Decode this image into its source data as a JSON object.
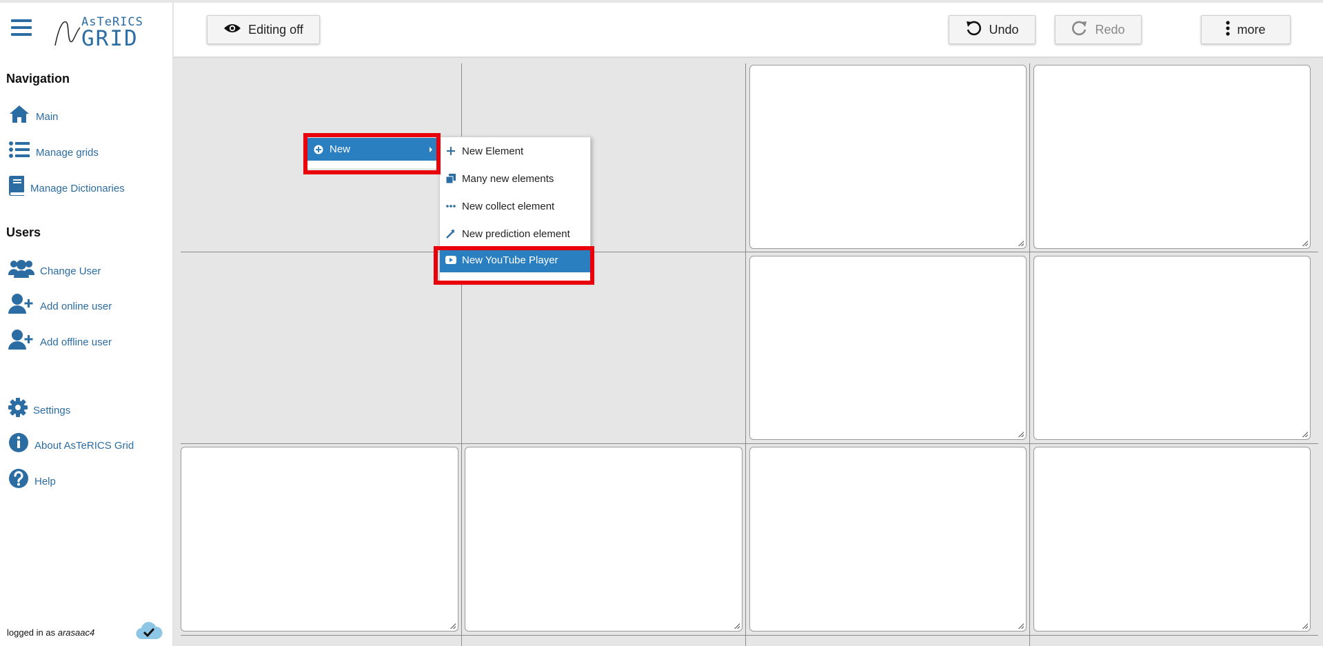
{
  "app": {
    "logo_top": "AsTeRICS",
    "logo_bottom": "GRID"
  },
  "sidebar": {
    "navigation_title": "Navigation",
    "users_title": "Users",
    "nav_items": [
      {
        "label": "Main",
        "icon": "home-icon"
      },
      {
        "label": "Manage grids",
        "icon": "list-icon"
      },
      {
        "label": "Manage Dictionaries",
        "icon": "book-icon"
      }
    ],
    "user_items": [
      {
        "label": "Change User",
        "icon": "users-icon"
      },
      {
        "label": "Add online user",
        "icon": "user-plus-icon"
      },
      {
        "label": "Add offline user",
        "icon": "user-plus-icon"
      }
    ],
    "other_items": [
      {
        "label": "Settings",
        "icon": "gear-icon"
      },
      {
        "label": "About AsTeRICS Grid",
        "icon": "info-icon"
      },
      {
        "label": "Help",
        "icon": "question-icon"
      }
    ],
    "login_prefix": "logged in as",
    "login_user": "arasaac4",
    "sync_icon": "cloud-check-icon"
  },
  "toolbar": {
    "editing_label": "Editing off",
    "undo_label": "Undo",
    "redo_label": "Redo",
    "more_label": "more"
  },
  "context_menu": {
    "new_label": "New",
    "submenu": [
      {
        "label": "New Element",
        "icon": "plus-icon"
      },
      {
        "label": "Many new elements",
        "icon": "copy-icon"
      },
      {
        "label": "New collect element",
        "icon": "dots-icon"
      },
      {
        "label": "New prediction element",
        "icon": "magic-wand-icon"
      },
      {
        "label": "New YouTube Player",
        "icon": "youtube-icon",
        "highlighted": true
      }
    ]
  },
  "colors": {
    "accent": "#2b6ca3",
    "highlight": "#2a7fc0",
    "annotation_red": "#e8000b",
    "grid_background": "#e6e6e6"
  }
}
